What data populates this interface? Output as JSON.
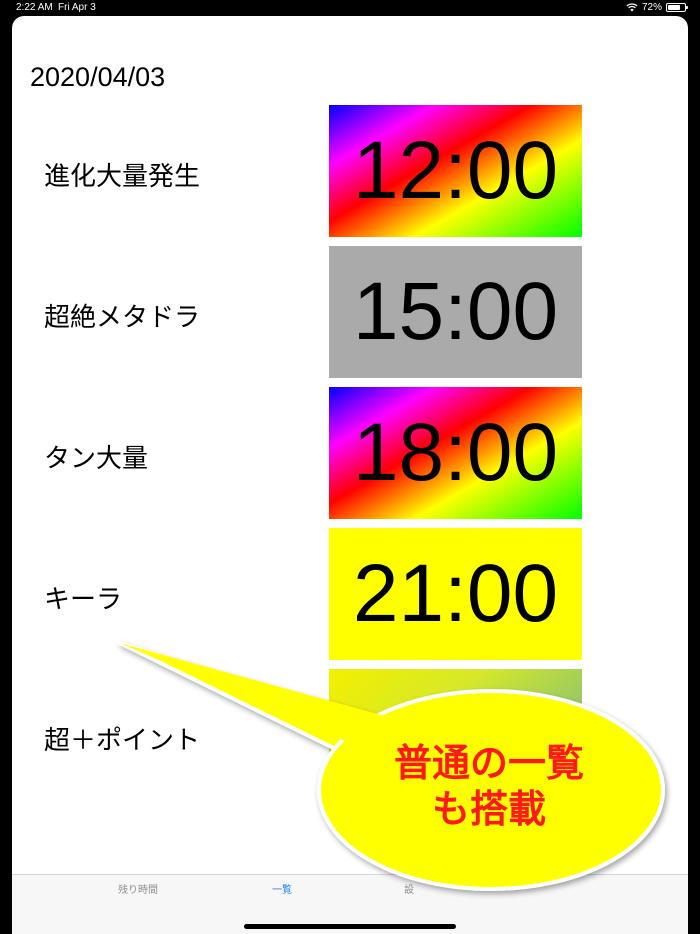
{
  "status_bar": {
    "time": "2:22 AM",
    "date": "Fri Apr 3",
    "battery": "72%",
    "battery_level": 0.72
  },
  "header": {
    "date": "2020/04/03"
  },
  "rows": [
    {
      "label": "進化大量発生",
      "time": "12:00",
      "style": "rainbow"
    },
    {
      "label": "超絶メタドラ",
      "time": "15:00",
      "style": "gray"
    },
    {
      "label": "タン大量",
      "time": "18:00",
      "style": "rainbow"
    },
    {
      "label": "キーラ",
      "time": "21:00",
      "style": "yellow"
    },
    {
      "label": "超＋ポイント",
      "time": "",
      "style": "partial"
    }
  ],
  "tabs": [
    {
      "label": "残り時間",
      "active": false
    },
    {
      "label": "一覧",
      "active": true
    },
    {
      "label": "設",
      "active": false
    }
  ],
  "callout": {
    "line1": "普通の一覧",
    "line2": "も搭載",
    "fill_color": "#ffff00",
    "text_color": "#ff1a1a"
  }
}
